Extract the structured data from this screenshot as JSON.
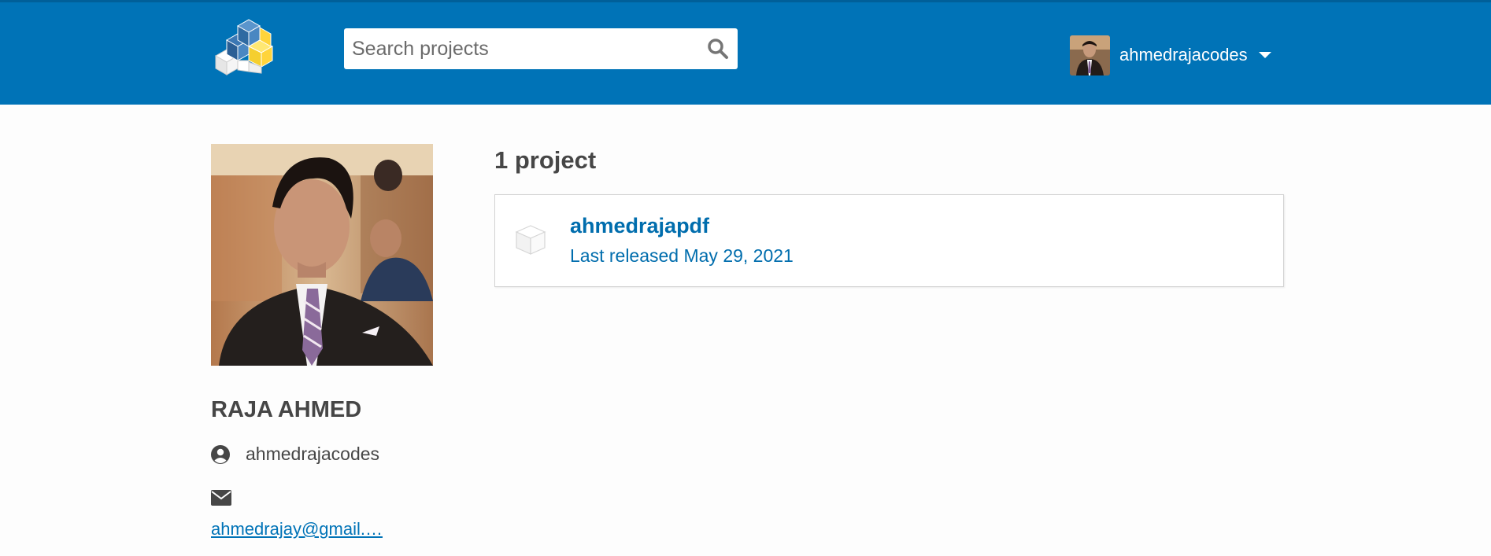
{
  "header": {
    "logo_icon": "pypi-logo-icon",
    "search": {
      "placeholder": "Search projects",
      "value": "",
      "icon": "search-icon"
    },
    "user": {
      "name": "ahmedrajacodes",
      "menu_icon": "caret-down-icon"
    },
    "brand_color": "#0073b7"
  },
  "profile": {
    "full_name": "RAJA AHMED",
    "username": "ahmedrajacodes",
    "username_icon": "user-circle-icon",
    "email_icon": "envelope-icon",
    "email": "ahmedrajay@gmail.…"
  },
  "projects": {
    "count_label": "1 project",
    "items": [
      {
        "name": "ahmedrajapdf",
        "released": "Last released May 29, 2021",
        "icon": "package-box-icon"
      }
    ]
  }
}
